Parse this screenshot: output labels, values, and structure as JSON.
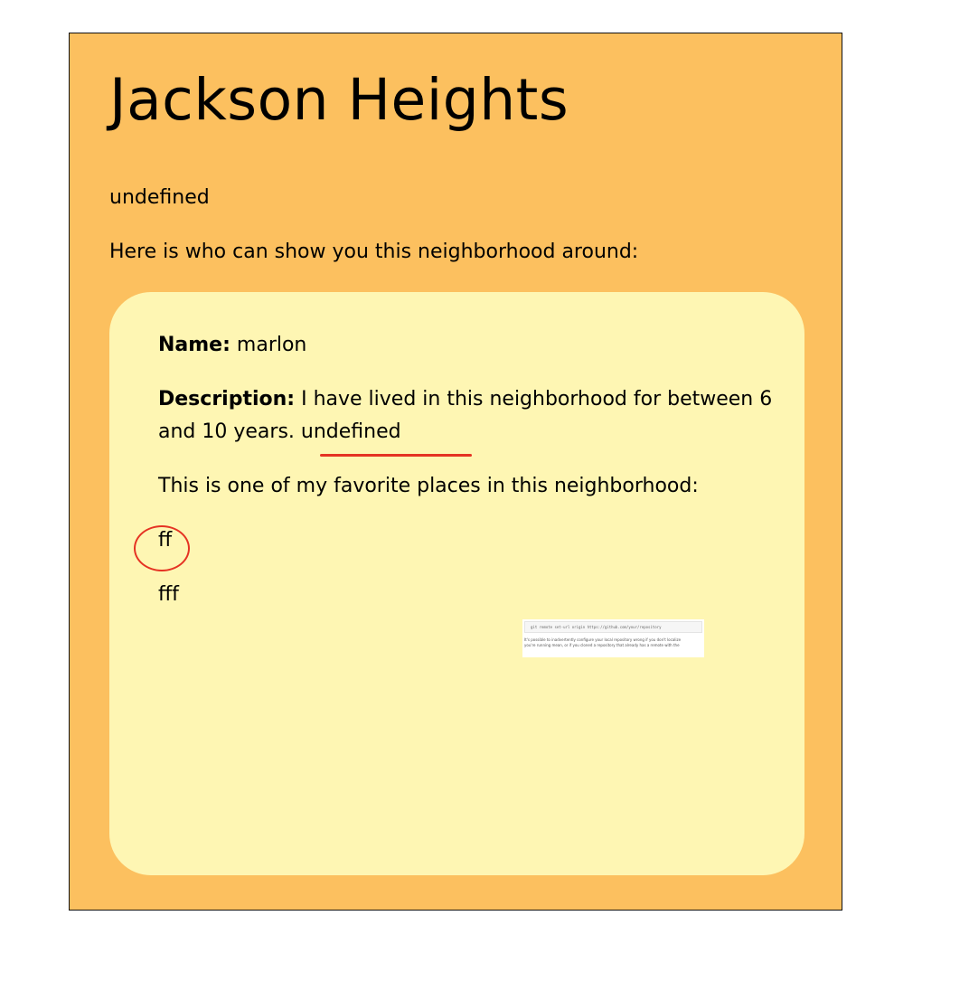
{
  "neighborhood": {
    "title": "Jackson Heights",
    "description": "undefined",
    "guides_intro": "Here is who can show you this neighborhood around:"
  },
  "guide": {
    "name_label": "Name:",
    "name_value": "marlon",
    "description_label": "Description:",
    "description_value": "I have lived in this neighborhood for between 6 and 10 years. undefined",
    "favorite_intro": "This is one of my favorite places in this neighborhood:",
    "favorite_place_name": "ff",
    "favorite_place_detail": "fff",
    "image_thumbnail": {
      "code_line": "git remote set-url origin https://github.com/your/repository",
      "text_line_1": "It's possible to inadvertently configure your local repository wrong if you don't localize",
      "text_line_2": "you're running mean, or if you cloned a repository that already has a remote with the"
    }
  },
  "colors": {
    "outer_background": "#fcc05f",
    "card_background": "#fef6b3",
    "annotation_red": "#e53323"
  }
}
